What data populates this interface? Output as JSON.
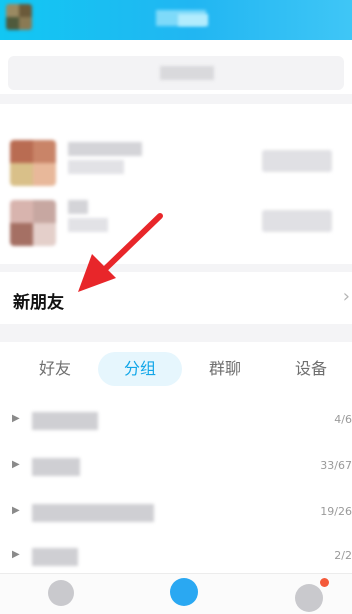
{
  "header": {
    "accent": "#12c7f3"
  },
  "new_friends": {
    "label": "新朋友",
    "chevron": "›"
  },
  "tabs": [
    {
      "label": "好友",
      "active": false
    },
    {
      "label": "分组",
      "active": true
    },
    {
      "label": "群聊",
      "active": false
    },
    {
      "label": "设备",
      "active": false
    }
  ],
  "groups": [
    {
      "count": "4/6"
    },
    {
      "count": "33/67"
    },
    {
      "count": "19/26"
    },
    {
      "count": "2/2"
    }
  ],
  "colors": {
    "accent": "#11a6e8",
    "badge": "#f45a3a",
    "arrow": "#e8262a"
  }
}
